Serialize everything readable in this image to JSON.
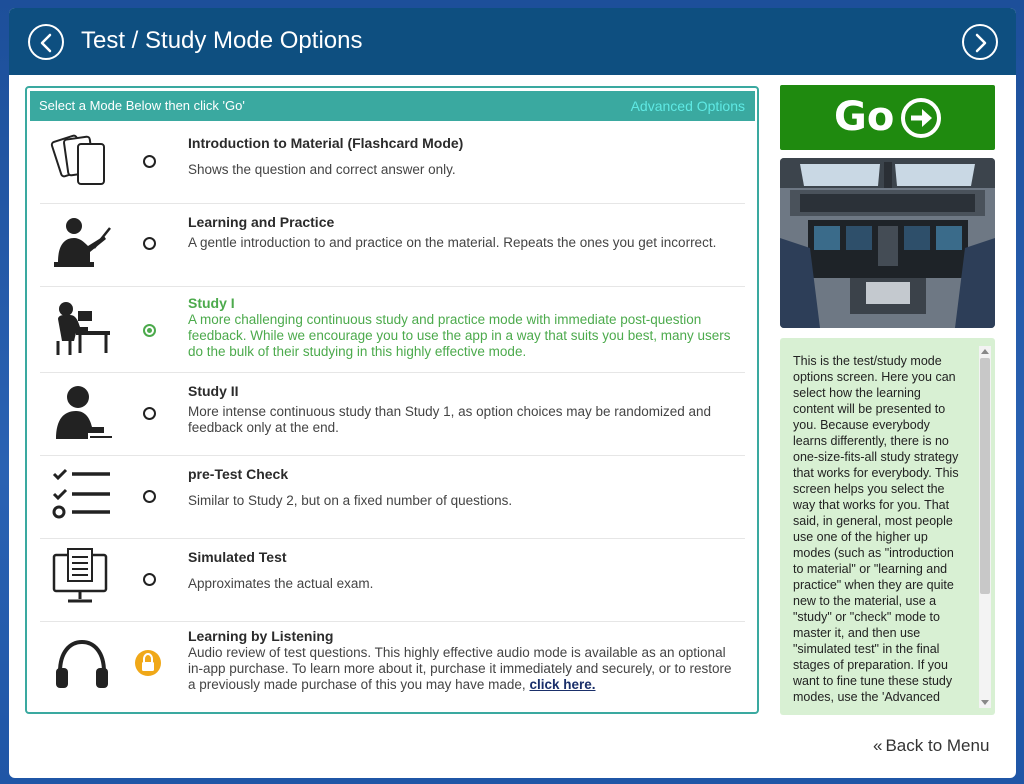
{
  "header": {
    "title": "Test / Study Mode Options",
    "back_icon": "chevron-left-circle-icon",
    "forward_icon": "chevron-right-circle-icon"
  },
  "modes_panel": {
    "bar_label": "Select a Mode Below then click 'Go'",
    "advanced_options": "Advanced Options",
    "modes": [
      {
        "id": "flashcard",
        "icon": "flashcards-icon",
        "title": "Introduction to Material (Flashcard Mode)",
        "description": "Shows the question and correct answer only.",
        "selected": false
      },
      {
        "id": "learning",
        "icon": "teacher-icon",
        "title": "Learning and Practice",
        "description": "A gentle introduction to and practice on the material. Repeats the ones you get incorrect.",
        "selected": false
      },
      {
        "id": "study1",
        "icon": "student-desk-icon",
        "title": "Study I",
        "description": "A more challenging continuous study and practice mode with immediate post-question feedback. While we encourage you to use the app in a way that suits you best, many users do the bulk of their studying in this highly effective mode.",
        "selected": true
      },
      {
        "id": "study2",
        "icon": "person-writing-icon",
        "title": "Study II",
        "description": "More intense continuous study than Study 1, as option choices may be randomized and feedback only at the end.",
        "selected": false
      },
      {
        "id": "pretest",
        "icon": "checklist-icon",
        "title": "pre-Test Check",
        "description": "Similar to Study 2, but on a fixed number of questions.",
        "selected": false
      },
      {
        "id": "simulated",
        "icon": "computer-test-icon",
        "title": "Simulated Test",
        "description": "Approximates the actual exam.",
        "selected": false
      },
      {
        "id": "listening",
        "icon": "headphones-icon",
        "title": "Learning by Listening",
        "description": "Audio review of test questions. This highly effective audio mode is available as an optional in-app purchase. To learn more about it, purchase it immediately and securely, or to restore a previously made purchase of this you may have made,",
        "link": "click here.",
        "locked": true
      }
    ]
  },
  "go_button": {
    "label": "Go",
    "icon": "arrow-right-circle-icon",
    "color": "#1f8a0f"
  },
  "help_text": "This is the test/study mode options screen. Here you can select how the learning content will be presented to you. Because everybody learns differently, there is no one-size-fits-all study strategy that works for everybody. This screen helps you select the way that works for you. That said, in general, most people use one of the higher up modes (such as \"introduction to material\" or \"learning and practice\" when they are quite new to the material, use a \"study\" or \"check\" mode to master it, and then use \"simulated test\" in the final stages of preparation. If you want to fine tune these study modes, use the 'Advanced",
  "footer": {
    "back_to_menu": "Back to Menu",
    "back_icon": "double-chevron-left-icon"
  },
  "colors": {
    "header": "#0e4f80",
    "accent": "#3aa9a0",
    "selected": "#4caa4c",
    "lock": "#f0a818",
    "help_bg": "#d8f0d3"
  }
}
